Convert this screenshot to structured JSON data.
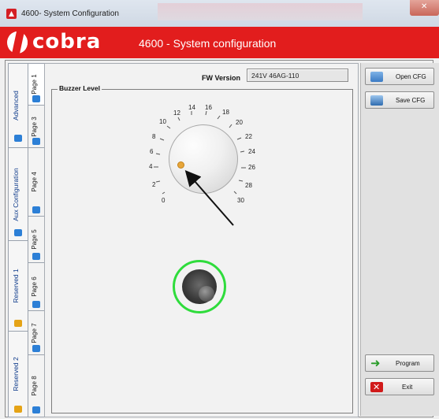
{
  "window": {
    "title": "4600- System Configuration"
  },
  "banner": {
    "logo_text": "cobra",
    "heading": "4600 - System configuration"
  },
  "fw": {
    "label": "FW Version",
    "value": "241V 46AG-110"
  },
  "group": {
    "label": "Buzzer Level"
  },
  "knob": {
    "ticks": [
      "0",
      "2",
      "4",
      "6",
      "8",
      "10",
      "12",
      "14",
      "16",
      "18",
      "20",
      "22",
      "24",
      "26",
      "28",
      "30"
    ],
    "value": "5"
  },
  "sections": [
    {
      "label": "Advanced",
      "pages": [
        "Page 1",
        "Page 3"
      ]
    },
    {
      "label": "Aux Configuration",
      "pages": [
        "Page 4",
        "Page 5"
      ]
    },
    {
      "label": "Reserved 1",
      "pages": [
        "Page 6",
        "Page 7"
      ]
    },
    {
      "label": "Reserved 2",
      "pages": [
        "Page 8"
      ]
    }
  ],
  "buttons": {
    "open_cfg": "Open CFG",
    "save_cfg": "Save CFG",
    "program": "Program",
    "exit": "Exit"
  }
}
